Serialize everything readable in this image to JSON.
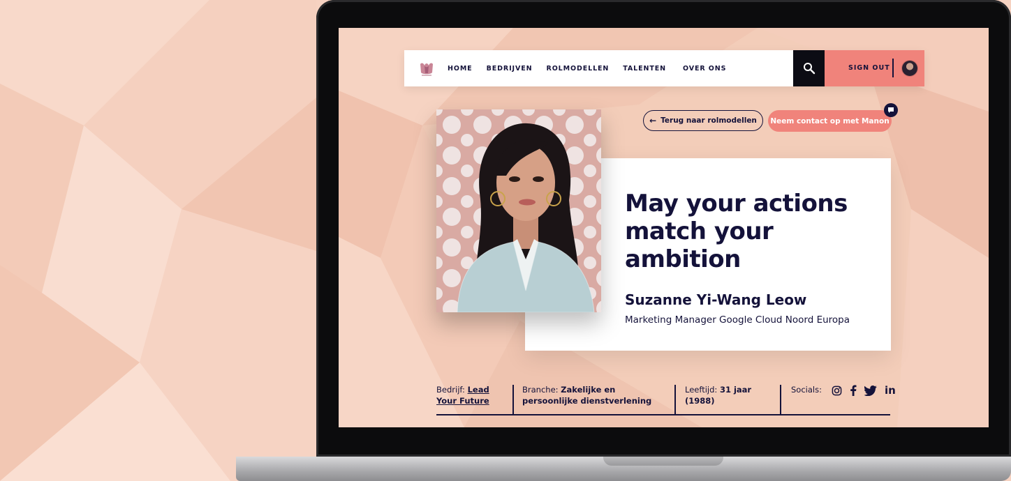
{
  "nav": {
    "logo_icon": "tulip-logo-icon",
    "links": [
      "HOME",
      "BEDRIJVEN",
      "ROLMODELLEN",
      "TALENTEN",
      "OVER ONS"
    ],
    "search_icon": "search-icon",
    "sign_out_label": "SIGN OUT",
    "avatar_icon": "avatar-icon"
  },
  "actions": {
    "back_label": "Terug naar rolmodellen",
    "contact_label": "Neem contact op met Manon",
    "chat_icon": "chat-bubble-icon"
  },
  "profile": {
    "quote": "May your actions match your ambition",
    "name": "Suzanne Yi-Wang Leow",
    "role": "Marketing Manager Google Cloud Noord Europa"
  },
  "info": {
    "company_label": "Bedrijf:",
    "company_value": "Lead Your Future",
    "branche_label": "Branche:",
    "branche_value": "Zakelijke en persoonlijke dienstverlening",
    "age_label": "Leeftijd:",
    "age_value": "31 jaar (1988)",
    "socials_label": "Socials:",
    "social_icons": [
      "instagram-icon",
      "facebook-icon",
      "twitter-icon",
      "linkedin-icon"
    ]
  },
  "colors": {
    "accent": "#f0837b",
    "navy": "#14123a",
    "background": "#f3cdb9"
  }
}
